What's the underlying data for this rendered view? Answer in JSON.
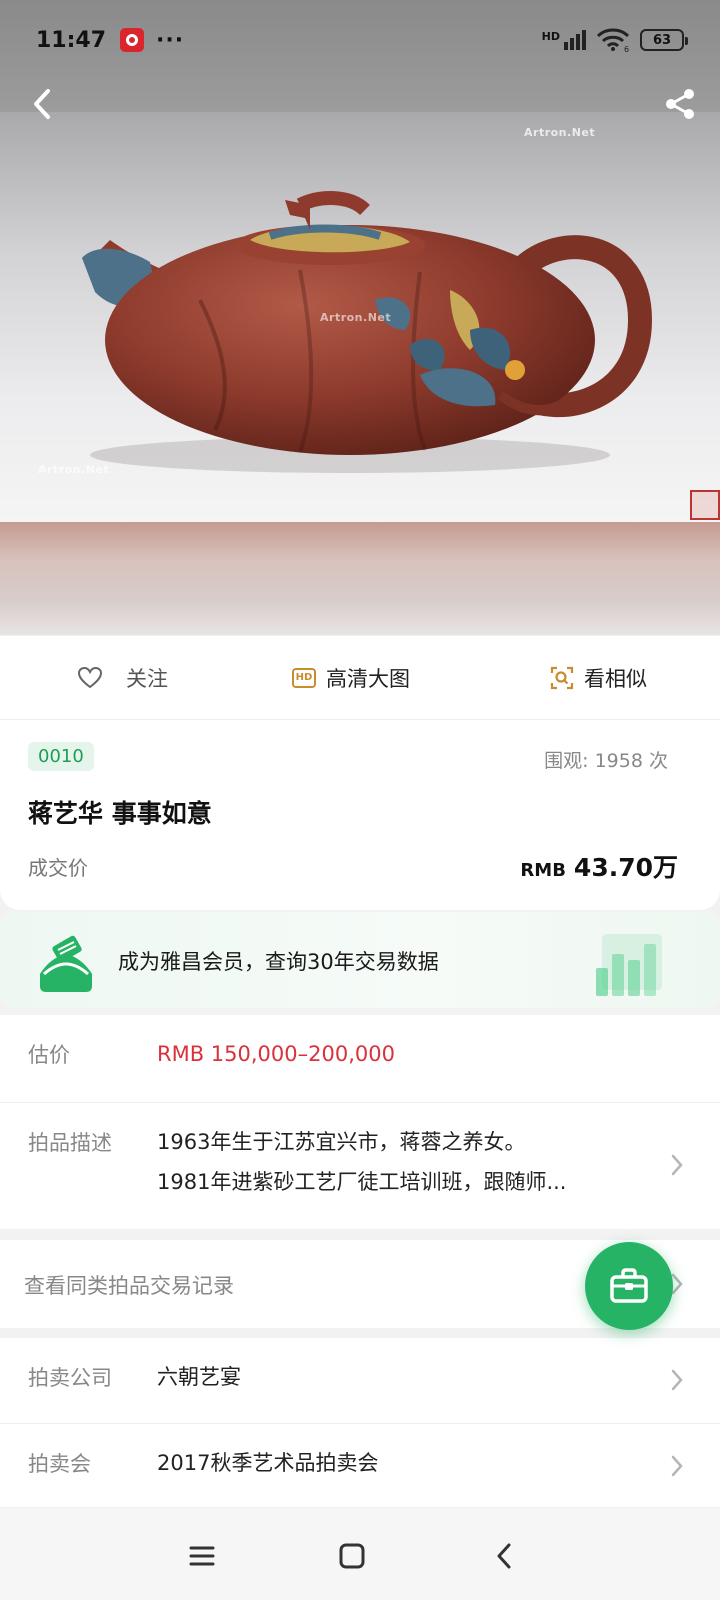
{
  "status_bar": {
    "time": "11:47",
    "dots": "···",
    "network": "HD",
    "wifi_label": "6",
    "battery": "63"
  },
  "hero": {
    "watermark": "Artron.Net",
    "icons": {
      "back": "back-arrow-icon",
      "share": "share-icon"
    }
  },
  "actions": {
    "follow": "关注",
    "hd": "高清大图",
    "hd_badge": "HD",
    "similar": "看相似"
  },
  "lot": {
    "number": "0010",
    "views": "围观: 1958  次",
    "title": "蒋艺华 事事如意",
    "price_label": "成交价",
    "price_currency": "RMB",
    "price_amount": "43.70万"
  },
  "member_banner": {
    "text": "成为雅昌会员，查询30年交易数据",
    "accent": "#27b365"
  },
  "details": {
    "estimate_label": "估价",
    "estimate_value": "RMB  150,000–200,000",
    "desc_label": "拍品描述",
    "desc_line1": "1963年生于江苏宜兴市，蒋蓉之养女。",
    "desc_line2": "1981年进紫砂工艺厂徒工培训班，跟随师..."
  },
  "records": {
    "label": "查看同类拍品交易记录"
  },
  "auction": {
    "company_label": "拍卖公司",
    "company_value": "六朝艺宴",
    "session_label": "拍卖会",
    "session_value": "2017秋季艺术品拍卖会"
  },
  "colors": {
    "price_red": "#d8323a",
    "brand_green": "#27b365",
    "hd_gold": "#c98d2b"
  }
}
